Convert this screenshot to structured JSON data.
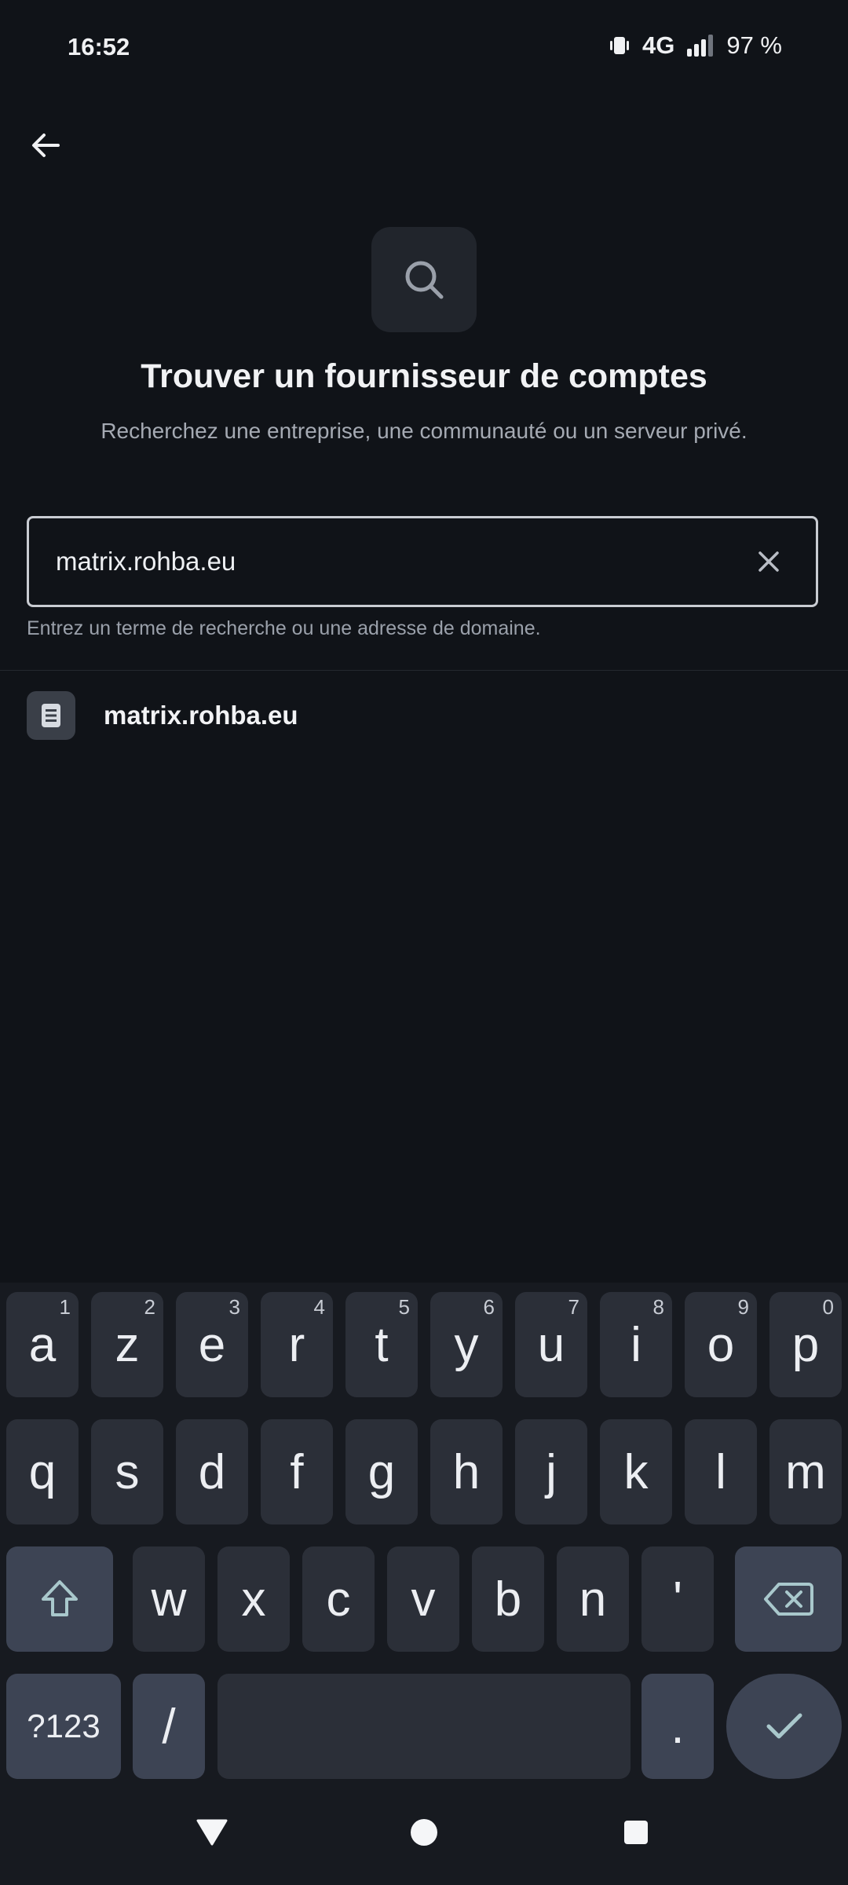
{
  "status_bar": {
    "time": "16:52",
    "network": "4G",
    "battery": "97 %"
  },
  "header": {
    "back_icon": "arrow-left-icon",
    "hero_icon": "search-icon",
    "title": "Trouver un fournisseur de comptes",
    "subtitle": "Recherchez une entreprise, une communauté ou un serveur privé."
  },
  "search": {
    "value": "matrix.rohba.eu",
    "clear_icon": "close-icon",
    "helper": "Entrez un terme de recherche ou une adresse de domaine."
  },
  "results": [
    {
      "label": "matrix.rohba.eu",
      "icon": "server-icon"
    }
  ],
  "keyboard": {
    "row1": [
      {
        "key": "a",
        "hint": "1"
      },
      {
        "key": "z",
        "hint": "2"
      },
      {
        "key": "e",
        "hint": "3"
      },
      {
        "key": "r",
        "hint": "4"
      },
      {
        "key": "t",
        "hint": "5"
      },
      {
        "key": "y",
        "hint": "6"
      },
      {
        "key": "u",
        "hint": "7"
      },
      {
        "key": "i",
        "hint": "8"
      },
      {
        "key": "o",
        "hint": "9"
      },
      {
        "key": "p",
        "hint": "0"
      }
    ],
    "row2": [
      "q",
      "s",
      "d",
      "f",
      "g",
      "h",
      "j",
      "k",
      "l",
      "m"
    ],
    "row3": [
      "w",
      "x",
      "c",
      "v",
      "b",
      "n",
      "'"
    ],
    "symbols": "?123",
    "slash": "/",
    "period": ".",
    "shift_icon": "shift-icon",
    "backspace_icon": "backspace-icon",
    "enter_icon": "checkmark-icon"
  },
  "colors": {
    "background": "#101318",
    "keyboard_bg": "#171a20",
    "key": "#2b2f38",
    "function_key": "#3d4454"
  }
}
